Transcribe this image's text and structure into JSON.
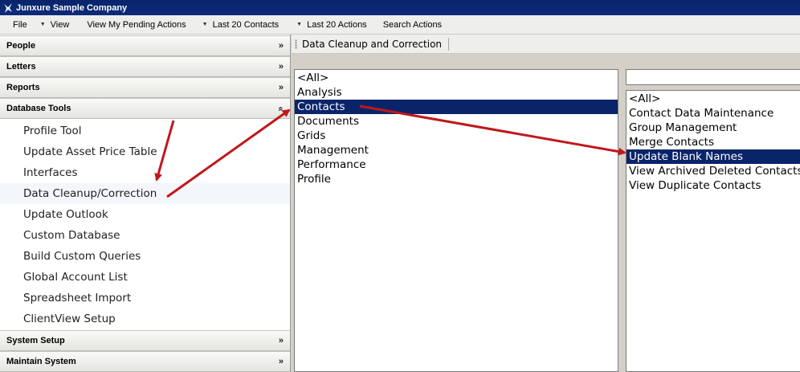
{
  "window": {
    "title": "Junxure Sample Company",
    "icon": "junxure-logo-icon"
  },
  "menubar": {
    "items": [
      {
        "label": "File",
        "dropdown": false
      },
      {
        "label": "View",
        "dropdown": true
      },
      {
        "label": "View My Pending Actions",
        "dropdown": false
      },
      {
        "label": "Last 20 Contacts",
        "dropdown": true
      },
      {
        "label": "Last 20 Actions",
        "dropdown": true
      },
      {
        "label": "Search Actions",
        "dropdown": false
      }
    ]
  },
  "sidebar": {
    "sections": {
      "people": {
        "label": "People",
        "state": "collapsed"
      },
      "letters": {
        "label": "Letters",
        "state": "collapsed"
      },
      "reports": {
        "label": "Reports",
        "state": "collapsed"
      },
      "database_tools": {
        "label": "Database Tools",
        "state": "expanded"
      },
      "system_setup": {
        "label": "System Setup",
        "state": "collapsed"
      },
      "maintain_system": {
        "label": "Maintain System",
        "state": "collapsed"
      }
    },
    "database_tools_items": [
      "Profile Tool",
      "Update Asset Price Table",
      "Interfaces",
      "Data Cleanup/Correction",
      "Update Outlook",
      "Custom Database",
      "Build Custom Queries",
      "Global Account List",
      "Spreadsheet Import",
      "ClientView Setup"
    ],
    "highlighted_item": "Data Cleanup/Correction"
  },
  "content": {
    "header_title": "Data Cleanup and Correction",
    "category_list": {
      "items": [
        "<All>",
        "Analysis",
        "Contacts",
        "Documents",
        "Grids",
        "Management",
        "Performance",
        "Profile"
      ],
      "selected": "Contacts"
    },
    "filter": {
      "value": ""
    },
    "tool_list": {
      "items": [
        "<All>",
        "Contact Data Maintenance",
        "Group Management",
        "Merge Contacts",
        "Update Blank Names",
        "View Archived Deleted Contacts",
        "View Duplicate Contacts"
      ],
      "selected": "Update Blank Names"
    }
  },
  "colors": {
    "selection": "#0a246a",
    "annotation_arrow": "#c0181b",
    "title_bar": "#0a246a"
  }
}
